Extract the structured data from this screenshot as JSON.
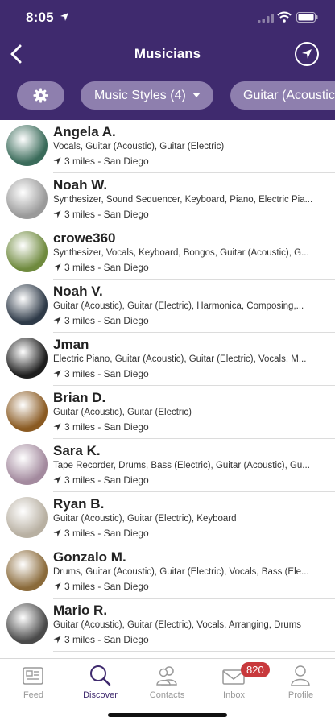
{
  "status_bar": {
    "time": "8:05"
  },
  "header": {
    "title": "Musicians"
  },
  "filters": {
    "music_styles": "Music Styles (4)",
    "instrument": "Guitar (Acoustic"
  },
  "musicians": [
    {
      "name": "Angela A.",
      "instruments": "Vocals, Guitar (Acoustic), Guitar (Electric)",
      "distance": "3 miles - San Diego",
      "avatar_color": "#3a6b5a"
    },
    {
      "name": "Noah W.",
      "instruments": "Synthesizer, Sound Sequencer, Keyboard, Piano, Electric Pia...",
      "distance": "3 miles - San Diego",
      "avatar_color": "#9a9a9a"
    },
    {
      "name": "crowe360",
      "instruments": "Synthesizer, Vocals, Keyboard, Bongos, Guitar (Acoustic), G...",
      "distance": "3 miles - San Diego",
      "avatar_color": "#6f8a3e"
    },
    {
      "name": "Noah V.",
      "instruments": "Guitar (Acoustic), Guitar (Electric), Harmonica, Composing,...",
      "distance": "3 miles - San Diego",
      "avatar_color": "#2e3a48"
    },
    {
      "name": "Jman",
      "instruments": "Electric Piano, Guitar (Acoustic), Guitar (Electric), Vocals, M...",
      "distance": "3 miles - San Diego",
      "avatar_color": "#1e1e1e"
    },
    {
      "name": "Brian D.",
      "instruments": "Guitar (Acoustic), Guitar (Electric)",
      "distance": "3 miles - San Diego",
      "avatar_color": "#8a5a22"
    },
    {
      "name": "Sara K.",
      "instruments": "Tape Recorder, Drums, Bass (Electric), Guitar (Acoustic), Gu...",
      "distance": "3 miles - San Diego",
      "avatar_color": "#a38a9e"
    },
    {
      "name": "Ryan B.",
      "instruments": "Guitar (Acoustic), Guitar (Electric), Keyboard",
      "distance": "3 miles - San Diego",
      "avatar_color": "#b8b0a2"
    },
    {
      "name": "Gonzalo M.",
      "instruments": "Drums, Guitar (Acoustic), Guitar (Electric), Vocals, Bass (Ele...",
      "distance": "3 miles - San Diego",
      "avatar_color": "#8a6a3a"
    },
    {
      "name": "Mario R.",
      "instruments": "Guitar (Acoustic), Guitar (Electric), Vocals, Arranging, Drums",
      "distance": "3 miles - San Diego",
      "avatar_color": "#4a4a4a"
    }
  ],
  "tabs": [
    {
      "label": "Feed",
      "icon": "newspaper-icon"
    },
    {
      "label": "Discover",
      "icon": "magnifier-icon"
    },
    {
      "label": "Contacts",
      "icon": "people-icon"
    },
    {
      "label": "Inbox",
      "icon": "envelope-icon",
      "badge": "820"
    },
    {
      "label": "Profile",
      "icon": "person-icon"
    }
  ],
  "colors": {
    "brand": "#3f2a6e",
    "chip": "#8e7fae",
    "badge": "#c8393c",
    "inactive_tab": "#999999"
  }
}
